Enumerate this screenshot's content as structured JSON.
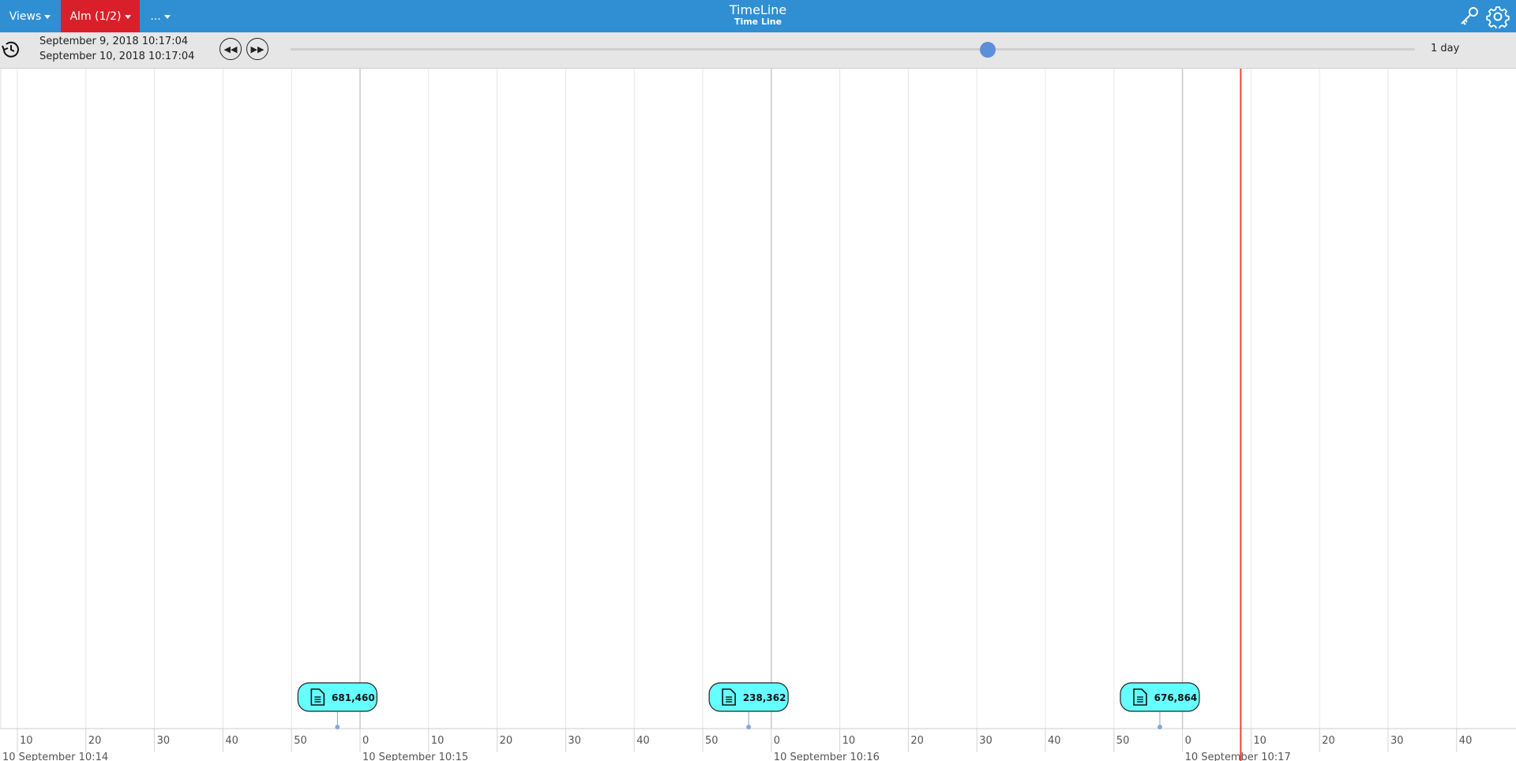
{
  "header": {
    "views_label": "Views",
    "alarm_label": "Alm (1/2)",
    "more_label": "...",
    "title": "TimeLine",
    "subtitle": "Time Line",
    "icons": [
      "key-icon",
      "gear-icon"
    ]
  },
  "toolbar": {
    "history_icon": "history-icon",
    "date_start": "September 9, 2018 10:17:04",
    "date_end": "September 10, 2018 10:17:04",
    "rewind_label": "◀◀",
    "forward_label": "▶▶",
    "range_label": "1 day",
    "slider_position": 0.62
  },
  "timeline": {
    "minor_tick_labels": [
      "10",
      "20",
      "30",
      "40",
      "50",
      "0",
      "10",
      "20",
      "30",
      "40",
      "50",
      "0",
      "10",
      "20",
      "30",
      "40",
      "50",
      "0",
      "10",
      "20",
      "30",
      "40"
    ],
    "major_labels": [
      "10 September 10:14",
      "10 September 10:15",
      "10 September 10:16",
      "10 September 10:17"
    ],
    "now_marker_color": "#e8463c",
    "events": [
      {
        "label": "681,460",
        "icon": "document-icon"
      },
      {
        "label": "238,362",
        "icon": "document-icon"
      },
      {
        "label": "676,864",
        "icon": "document-icon"
      }
    ],
    "event_color": "#66ffff"
  }
}
